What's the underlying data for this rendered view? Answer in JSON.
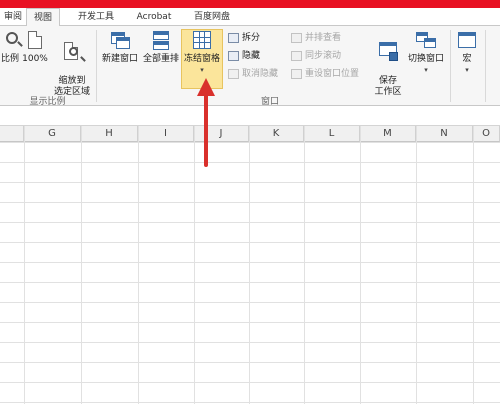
{
  "tabs": [
    {
      "label": "审阅"
    },
    {
      "label": "视图"
    },
    {
      "label": "开发工具"
    },
    {
      "label": "Acrobat"
    },
    {
      "label": "百度网盘"
    }
  ],
  "ribbon": {
    "zoom_group": {
      "zoom_label": "比例",
      "hundred_label": "100%",
      "zoom_selection_label": "缩放到\n选定区域",
      "group_label": "显示比例"
    },
    "window_group": {
      "new_window": "新建窗口",
      "arrange_all": "全部重排",
      "freeze_panes": "冻结窗格",
      "split": "拆分",
      "hide": "隐藏",
      "unhide": "取消隐藏",
      "side_by_side": "并排查看",
      "sync_scroll": "同步滚动",
      "reset_position": "重设窗口位置",
      "save_workspace": "保存\n工作区",
      "switch_windows": "切换窗口",
      "group_label": "窗口"
    },
    "macro_group": {
      "macros": "宏"
    }
  },
  "columns": [
    "G",
    "H",
    "I",
    "J",
    "K",
    "L",
    "M",
    "N",
    "O"
  ],
  "colors": {
    "top_bar": "#e81123",
    "freeze_highlight": "#fbe59b",
    "arrow": "#d9302c"
  }
}
